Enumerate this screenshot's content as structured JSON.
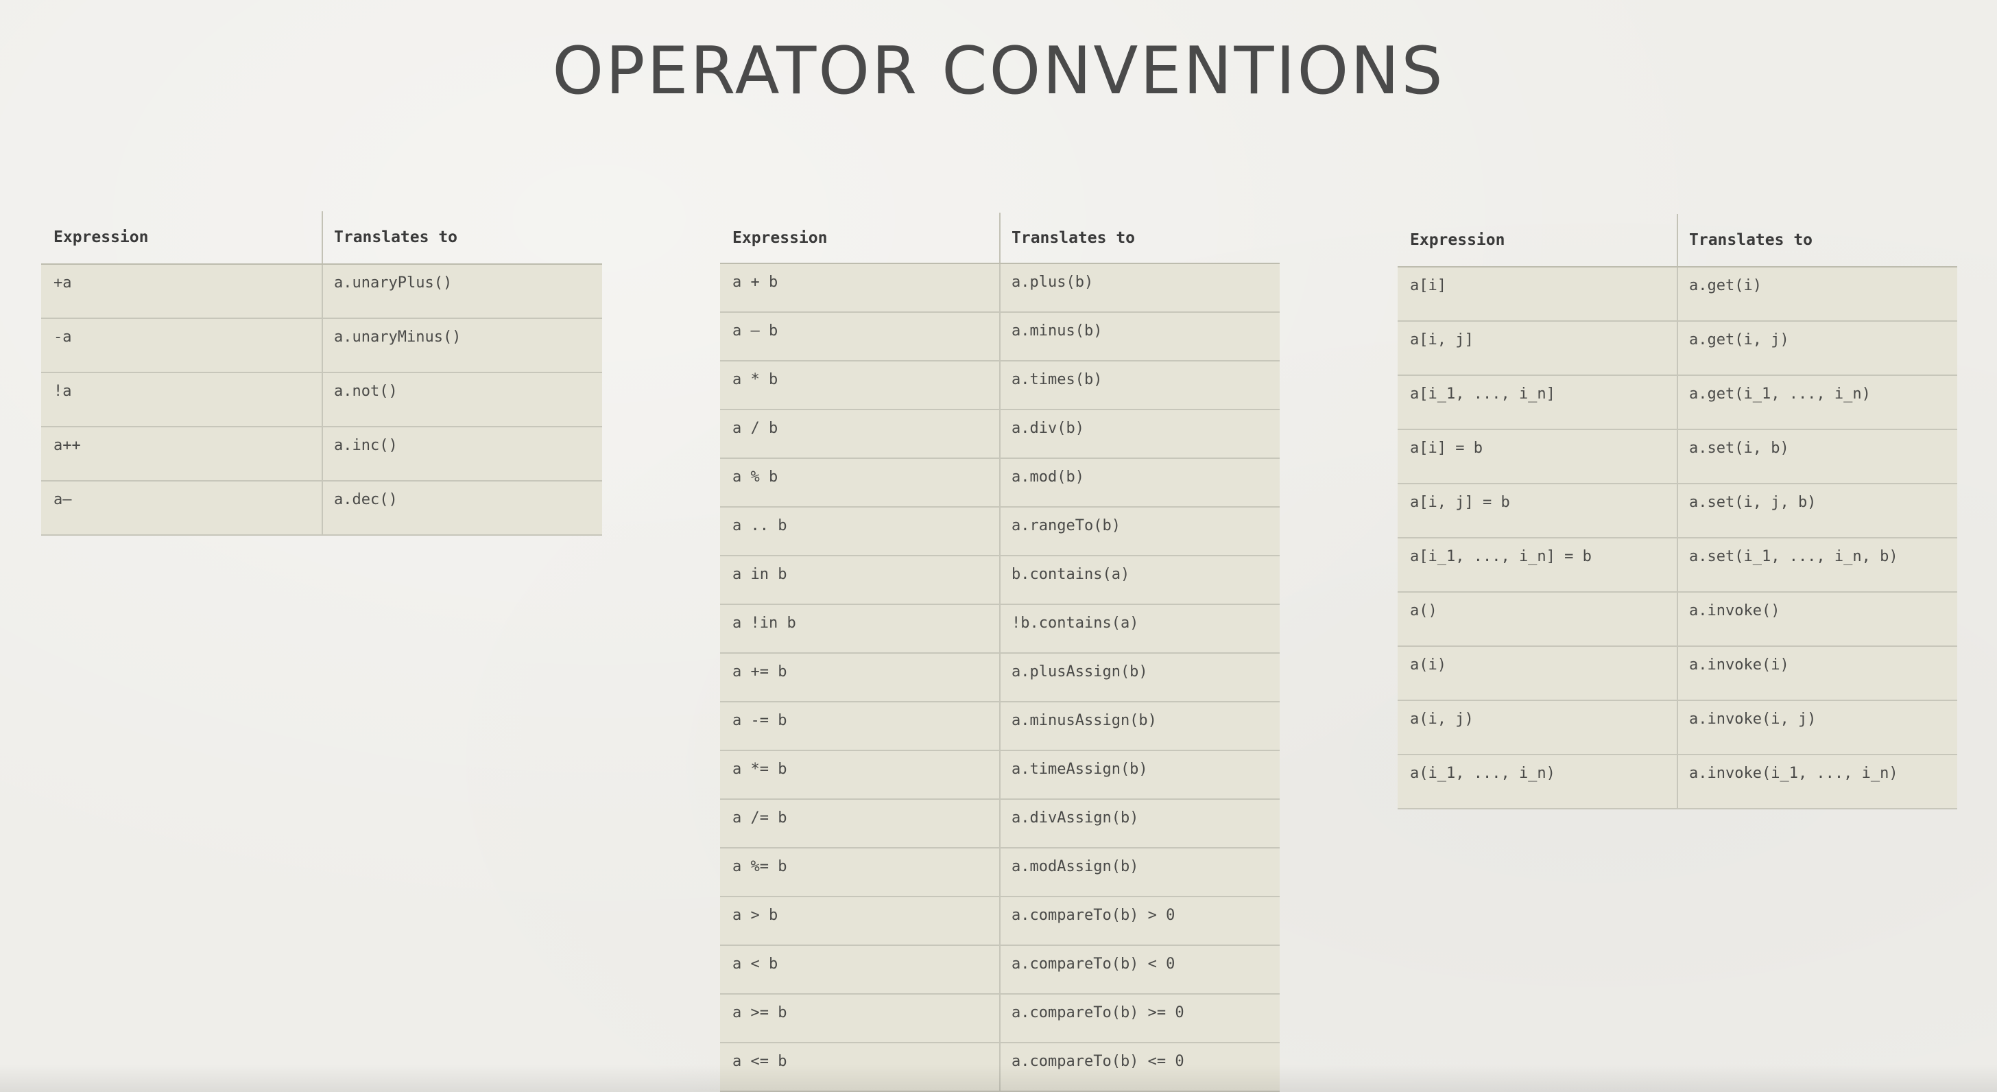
{
  "title": "OPERATOR CONVENTIONS",
  "colors": {
    "background": "#efeeea",
    "cell_background": "#e6e4d7",
    "title_text": "#4a4a4a",
    "cell_text": "#4a4a48"
  },
  "tables": [
    {
      "headers": [
        "Expression",
        "Translates to"
      ],
      "rows": [
        [
          "+a",
          "a.unaryPlus()"
        ],
        [
          "-a",
          "a.unaryMinus()"
        ],
        [
          "!a",
          "a.not()"
        ],
        [
          "a++",
          "a.inc()"
        ],
        [
          "a—",
          "a.dec()"
        ]
      ]
    },
    {
      "headers": [
        "Expression",
        "Translates to"
      ],
      "rows": [
        [
          "a + b",
          "a.plus(b)"
        ],
        [
          "a – b",
          "a.minus(b)"
        ],
        [
          "a * b",
          "a.times(b)"
        ],
        [
          "a / b",
          "a.div(b)"
        ],
        [
          "a % b",
          "a.mod(b)"
        ],
        [
          "a .. b",
          "a.rangeTo(b)"
        ],
        [
          "a in b",
          "b.contains(a)"
        ],
        [
          "a !in b",
          "!b.contains(a)"
        ],
        [
          "a += b",
          "a.plusAssign(b)"
        ],
        [
          "a -= b",
          "a.minusAssign(b)"
        ],
        [
          "a *= b",
          "a.timeAssign(b)"
        ],
        [
          "a /= b",
          "a.divAssign(b)"
        ],
        [
          "a %= b",
          "a.modAssign(b)"
        ],
        [
          "a > b",
          "a.compareTo(b) > 0"
        ],
        [
          "a < b",
          "a.compareTo(b) < 0"
        ],
        [
          "a >= b",
          "a.compareTo(b) >= 0"
        ],
        [
          "a <= b",
          "a.compareTo(b) <= 0"
        ]
      ]
    },
    {
      "headers": [
        "Expression",
        "Translates to"
      ],
      "rows": [
        [
          "a[i]",
          "a.get(i)"
        ],
        [
          "a[i, j]",
          "a.get(i, j)"
        ],
        [
          "a[i_1, ..., i_n]",
          "a.get(i_1, ..., i_n)"
        ],
        [
          "a[i] = b",
          "a.set(i, b)"
        ],
        [
          "a[i, j] = b",
          "a.set(i, j, b)"
        ],
        [
          "a[i_1, ..., i_n] = b",
          "a.set(i_1, ..., i_n, b)"
        ],
        [
          "a()",
          "a.invoke()"
        ],
        [
          "a(i)",
          "a.invoke(i)"
        ],
        [
          "a(i, j)",
          "a.invoke(i, j)"
        ],
        [
          "a(i_1, ..., i_n)",
          "a.invoke(i_1, ..., i_n)"
        ]
      ]
    }
  ]
}
